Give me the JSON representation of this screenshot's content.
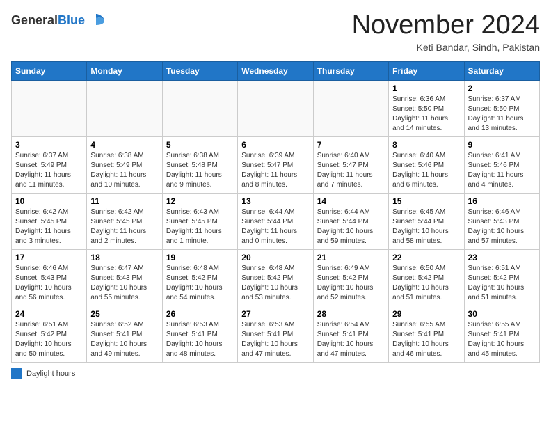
{
  "logo": {
    "general": "General",
    "blue": "Blue"
  },
  "title": "November 2024",
  "subtitle": "Keti Bandar, Sindh, Pakistan",
  "days_of_week": [
    "Sunday",
    "Monday",
    "Tuesday",
    "Wednesday",
    "Thursday",
    "Friday",
    "Saturday"
  ],
  "weeks": [
    [
      {
        "day": "",
        "info": ""
      },
      {
        "day": "",
        "info": ""
      },
      {
        "day": "",
        "info": ""
      },
      {
        "day": "",
        "info": ""
      },
      {
        "day": "",
        "info": ""
      },
      {
        "day": "1",
        "info": "Sunrise: 6:36 AM\nSunset: 5:50 PM\nDaylight: 11 hours and 14 minutes."
      },
      {
        "day": "2",
        "info": "Sunrise: 6:37 AM\nSunset: 5:50 PM\nDaylight: 11 hours and 13 minutes."
      }
    ],
    [
      {
        "day": "3",
        "info": "Sunrise: 6:37 AM\nSunset: 5:49 PM\nDaylight: 11 hours and 11 minutes."
      },
      {
        "day": "4",
        "info": "Sunrise: 6:38 AM\nSunset: 5:49 PM\nDaylight: 11 hours and 10 minutes."
      },
      {
        "day": "5",
        "info": "Sunrise: 6:38 AM\nSunset: 5:48 PM\nDaylight: 11 hours and 9 minutes."
      },
      {
        "day": "6",
        "info": "Sunrise: 6:39 AM\nSunset: 5:47 PM\nDaylight: 11 hours and 8 minutes."
      },
      {
        "day": "7",
        "info": "Sunrise: 6:40 AM\nSunset: 5:47 PM\nDaylight: 11 hours and 7 minutes."
      },
      {
        "day": "8",
        "info": "Sunrise: 6:40 AM\nSunset: 5:46 PM\nDaylight: 11 hours and 6 minutes."
      },
      {
        "day": "9",
        "info": "Sunrise: 6:41 AM\nSunset: 5:46 PM\nDaylight: 11 hours and 4 minutes."
      }
    ],
    [
      {
        "day": "10",
        "info": "Sunrise: 6:42 AM\nSunset: 5:45 PM\nDaylight: 11 hours and 3 minutes."
      },
      {
        "day": "11",
        "info": "Sunrise: 6:42 AM\nSunset: 5:45 PM\nDaylight: 11 hours and 2 minutes."
      },
      {
        "day": "12",
        "info": "Sunrise: 6:43 AM\nSunset: 5:45 PM\nDaylight: 11 hours and 1 minute."
      },
      {
        "day": "13",
        "info": "Sunrise: 6:44 AM\nSunset: 5:44 PM\nDaylight: 11 hours and 0 minutes."
      },
      {
        "day": "14",
        "info": "Sunrise: 6:44 AM\nSunset: 5:44 PM\nDaylight: 10 hours and 59 minutes."
      },
      {
        "day": "15",
        "info": "Sunrise: 6:45 AM\nSunset: 5:44 PM\nDaylight: 10 hours and 58 minutes."
      },
      {
        "day": "16",
        "info": "Sunrise: 6:46 AM\nSunset: 5:43 PM\nDaylight: 10 hours and 57 minutes."
      }
    ],
    [
      {
        "day": "17",
        "info": "Sunrise: 6:46 AM\nSunset: 5:43 PM\nDaylight: 10 hours and 56 minutes."
      },
      {
        "day": "18",
        "info": "Sunrise: 6:47 AM\nSunset: 5:43 PM\nDaylight: 10 hours and 55 minutes."
      },
      {
        "day": "19",
        "info": "Sunrise: 6:48 AM\nSunset: 5:42 PM\nDaylight: 10 hours and 54 minutes."
      },
      {
        "day": "20",
        "info": "Sunrise: 6:48 AM\nSunset: 5:42 PM\nDaylight: 10 hours and 53 minutes."
      },
      {
        "day": "21",
        "info": "Sunrise: 6:49 AM\nSunset: 5:42 PM\nDaylight: 10 hours and 52 minutes."
      },
      {
        "day": "22",
        "info": "Sunrise: 6:50 AM\nSunset: 5:42 PM\nDaylight: 10 hours and 51 minutes."
      },
      {
        "day": "23",
        "info": "Sunrise: 6:51 AM\nSunset: 5:42 PM\nDaylight: 10 hours and 51 minutes."
      }
    ],
    [
      {
        "day": "24",
        "info": "Sunrise: 6:51 AM\nSunset: 5:42 PM\nDaylight: 10 hours and 50 minutes."
      },
      {
        "day": "25",
        "info": "Sunrise: 6:52 AM\nSunset: 5:41 PM\nDaylight: 10 hours and 49 minutes."
      },
      {
        "day": "26",
        "info": "Sunrise: 6:53 AM\nSunset: 5:41 PM\nDaylight: 10 hours and 48 minutes."
      },
      {
        "day": "27",
        "info": "Sunrise: 6:53 AM\nSunset: 5:41 PM\nDaylight: 10 hours and 47 minutes."
      },
      {
        "day": "28",
        "info": "Sunrise: 6:54 AM\nSunset: 5:41 PM\nDaylight: 10 hours and 47 minutes."
      },
      {
        "day": "29",
        "info": "Sunrise: 6:55 AM\nSunset: 5:41 PM\nDaylight: 10 hours and 46 minutes."
      },
      {
        "day": "30",
        "info": "Sunrise: 6:55 AM\nSunset: 5:41 PM\nDaylight: 10 hours and 45 minutes."
      }
    ]
  ],
  "legend": {
    "box_label": "Daylight hours"
  }
}
